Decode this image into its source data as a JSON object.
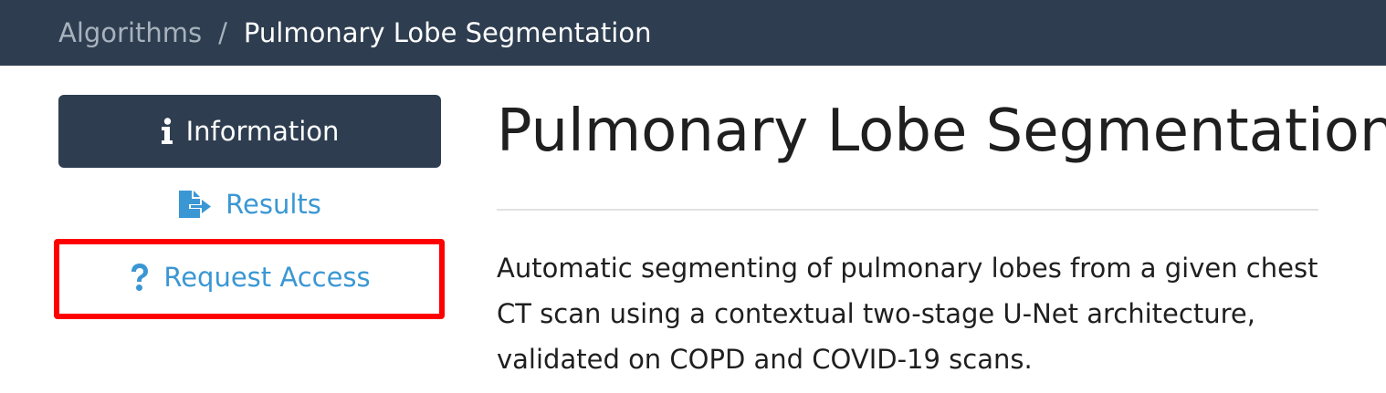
{
  "breadcrumb": {
    "root_label": "Algorithms",
    "separator": "/",
    "current_label": "Pulmonary Lobe Segmentation"
  },
  "sidebar": {
    "items": [
      {
        "label": "Information",
        "icon": "info-icon",
        "active": true
      },
      {
        "label": "Results",
        "icon": "file-export-icon",
        "active": false
      },
      {
        "label": "Request Access",
        "icon": "question-icon",
        "active": false,
        "highlighted": true
      }
    ]
  },
  "main": {
    "title": "Pulmonary Lobe Segmentation",
    "description": "Automatic segmenting of pulmonary lobes from a given chest CT scan using a contextual two-stage U-Net architecture, validated on COPD and COVID-19 scans."
  },
  "colors": {
    "topbar": "#2e3e50",
    "active_nav": "#2e3e50",
    "link": "#3a97d4",
    "highlight": "#ff0000"
  }
}
